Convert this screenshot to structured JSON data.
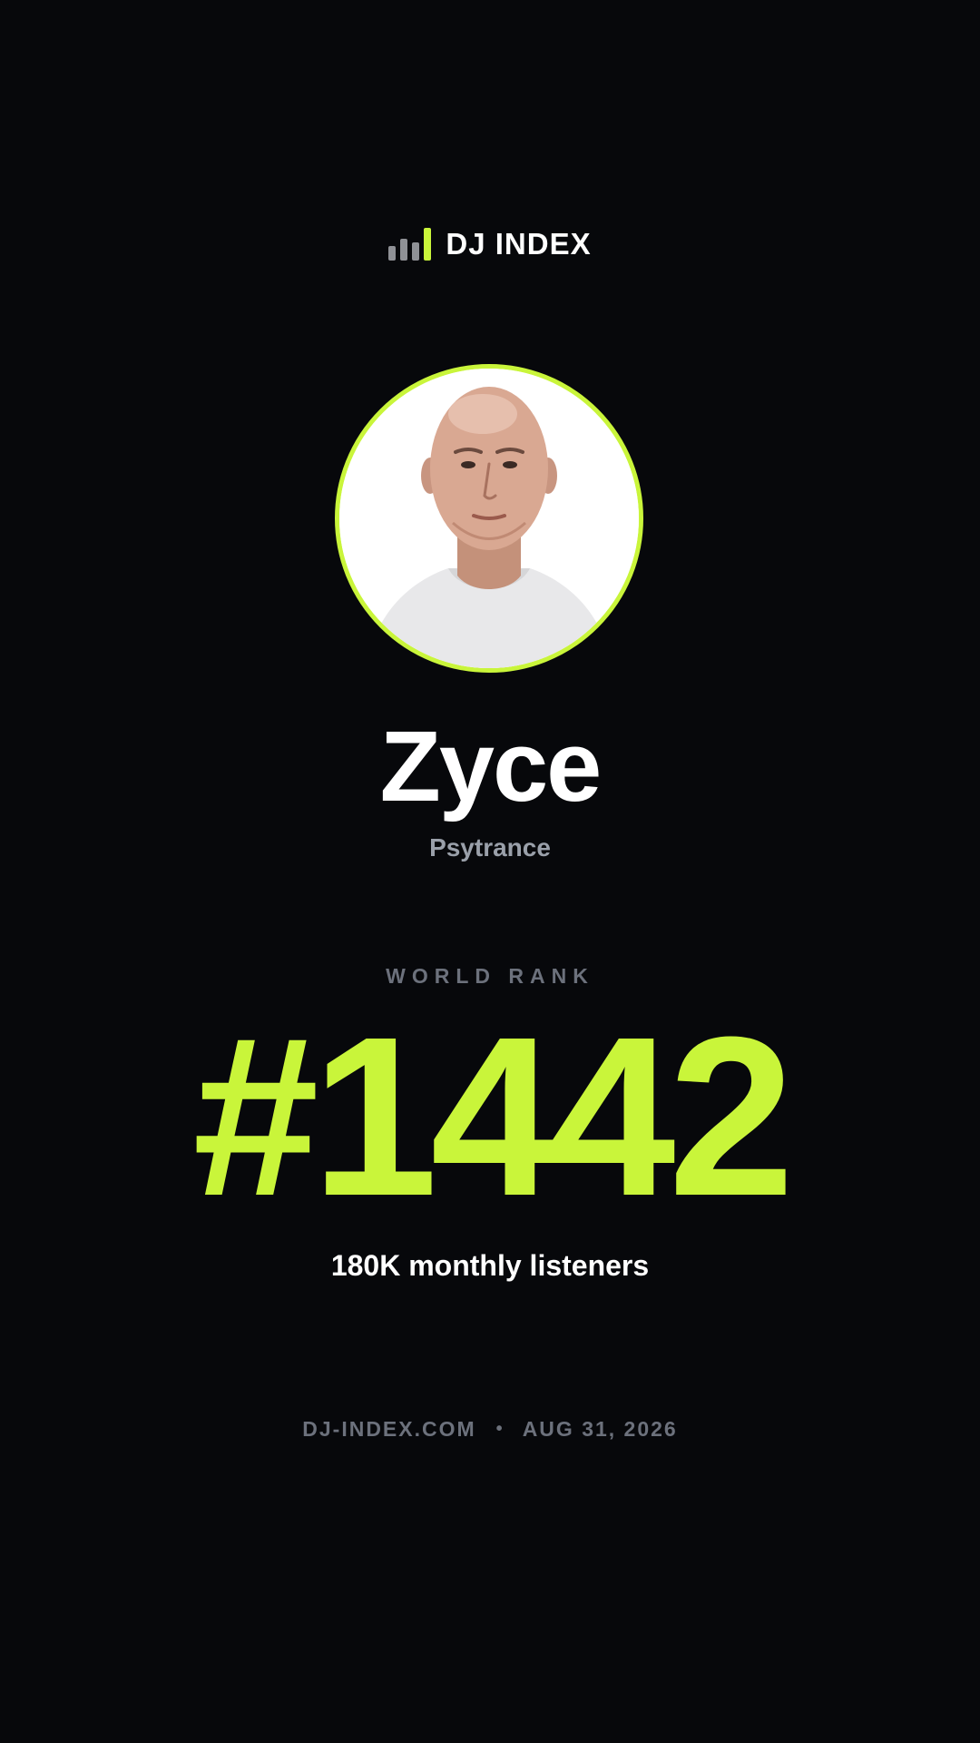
{
  "brand": {
    "name": "DJ INDEX",
    "icon": "bar-chart-icon",
    "accent_color": "#c9f53a"
  },
  "artist": {
    "name": "Zyce",
    "genre": "Psytrance",
    "avatar_icon": "artist-photo"
  },
  "rank": {
    "label": "WORLD RANK",
    "value": "#1442"
  },
  "stats": {
    "listeners": "180K monthly listeners"
  },
  "footer": {
    "site": "DJ-INDEX.COM",
    "separator": "•",
    "date": "AUG 31, 2026"
  }
}
